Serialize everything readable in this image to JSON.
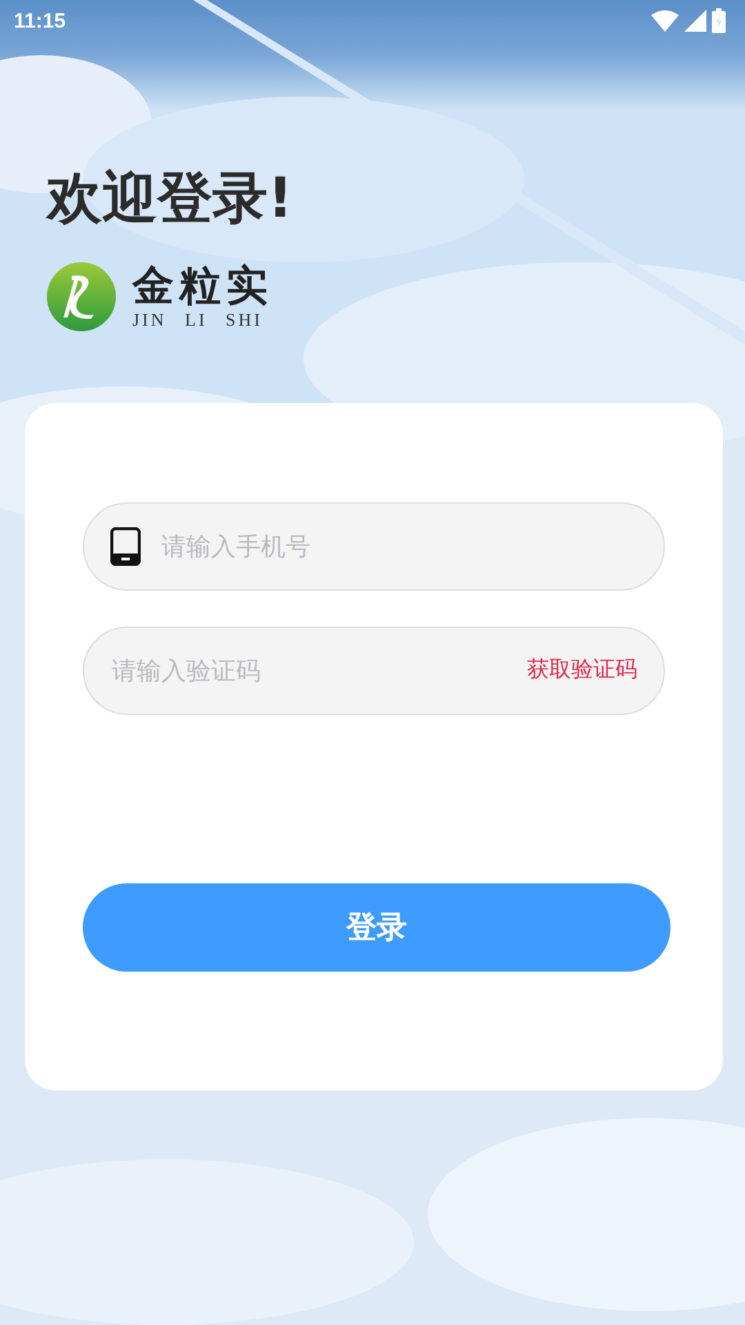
{
  "status_bar": {
    "time": "11:15"
  },
  "title": "欢迎登录!",
  "logo": {
    "chinese": "金粒实",
    "pinyin": "JIN LI SHI"
  },
  "form": {
    "phone_field": {
      "placeholder": "请输入手机号"
    },
    "code_field": {
      "placeholder": "请输入验证码"
    },
    "get_code_link": "获取验证码",
    "login_button": "登录"
  }
}
